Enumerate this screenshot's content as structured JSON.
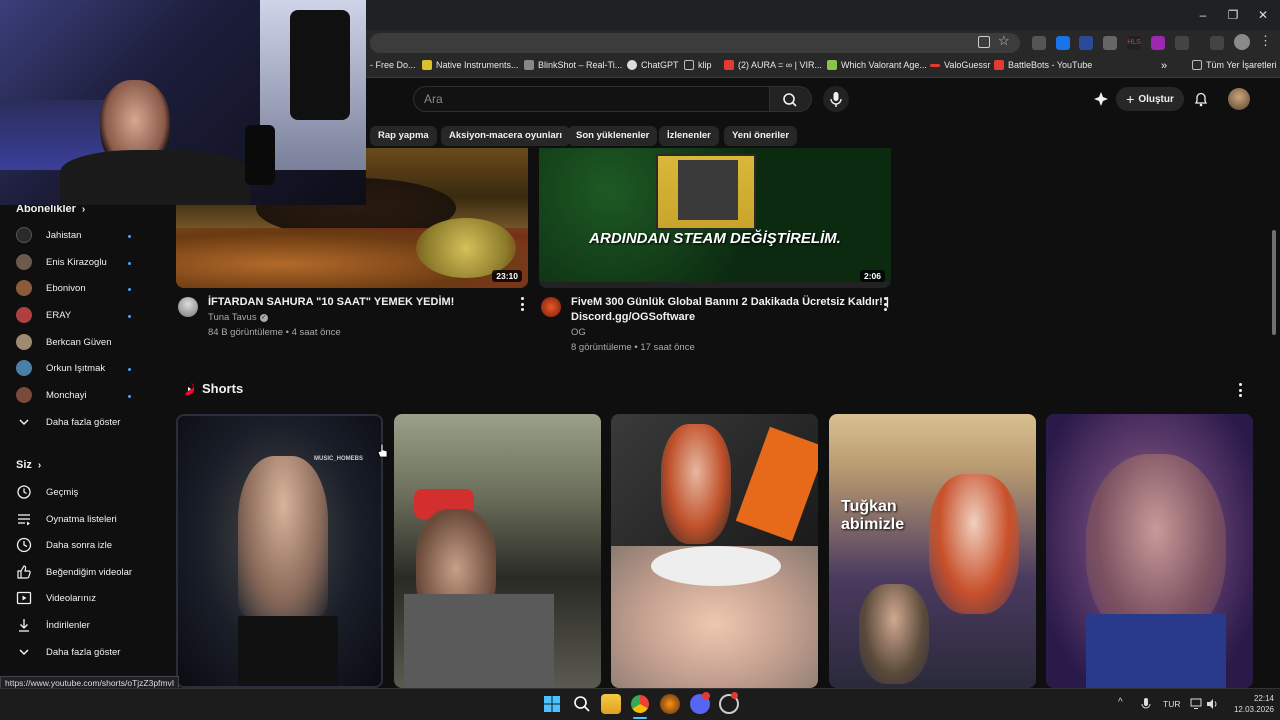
{
  "bookmarks": [
    {
      "label": "- Free Do...",
      "color": "#5f6368"
    },
    {
      "label": "Native Instruments...",
      "color": "#d9c12a"
    },
    {
      "label": "BlinkShot – Real-Ti...",
      "color": "#888888"
    },
    {
      "label": "ChatGPT",
      "color": "#dddddd"
    },
    {
      "label": "klip",
      "color": "#999999"
    },
    {
      "label": "(2) AURA = ∞ | VIR...",
      "color": "#e53935"
    },
    {
      "label": "Which Valorant Age...",
      "color": "#8bc34a"
    },
    {
      "label": "ValoGuessr",
      "color": "#e53935"
    },
    {
      "label": "BattleBots - YouTube",
      "color": "#e53935"
    }
  ],
  "bookmarks_more": "»",
  "all_bookmarks_label": "Tüm Yer İşaretleri",
  "search": {
    "placeholder": "Ara"
  },
  "header": {
    "create_label": "Oluştur"
  },
  "chips": [
    "Rap yapma",
    "Aksiyon-macera oyunları",
    "Son yüklenenler",
    "İzlenenler",
    "Yeni öneriler"
  ],
  "sidebar": {
    "subscriptions_heading": "Abonelikler",
    "subscriptions": [
      {
        "label": "Jahistan",
        "color": "#2a2a2a"
      },
      {
        "label": "Enis Kirazoglu",
        "color": "#6d5a4d"
      },
      {
        "label": "Ebonivon",
        "color": "#8a5a3a"
      },
      {
        "label": "ERAY",
        "color": "#b04040"
      },
      {
        "label": "Berkcan Güven",
        "color": "#a08a70"
      },
      {
        "label": "Orkun Işıtmak",
        "color": "#4a7fa8"
      },
      {
        "label": "Monchayi",
        "color": "#7a4a3a"
      }
    ],
    "show_more_1": "Daha fazla göster",
    "you_heading": "Siz",
    "you_items": [
      "Geçmiş",
      "Oynatma listeleri",
      "Daha sonra izle",
      "Beğendiğim videolar",
      "Videolarınız",
      "İndirilenler"
    ],
    "show_more_2": "Daha fazla göster"
  },
  "videos": [
    {
      "title": "İFTARDAN SAHURA \"10 SAAT\" YEMEK YEDİM!",
      "channel": "Tuna Tavus",
      "meta": "84 B görüntüleme • 4 saat önce",
      "duration": "23:10"
    },
    {
      "title_line1": "FiveM 300 Günlük Global Banını 2 Dakikada Ücretsiz Kaldır! |",
      "title_line2": "Discord.gg/OGSoftware",
      "channel": "OG",
      "meta": "8 görüntüleme • 17 saat önce",
      "duration": "2:06",
      "overlay_text": "ARDINDAN STEAM DEĞİŞTİRELİM."
    }
  ],
  "shorts": {
    "heading": "Shorts",
    "items": [
      {
        "overlay": "MUSIC_HOMEBS"
      },
      {
        "overlay": ""
      },
      {
        "overlay": ""
      },
      {
        "overlay": "Tuğkan abimizle"
      },
      {
        "overlay": ""
      }
    ]
  },
  "status_url": "https://www.youtube.com/shorts/oTjzZ3pfmvI",
  "taskbar": {
    "lang": "TUR",
    "time": "22:14",
    "date": "12.03.2026",
    "tray_up": "^"
  }
}
